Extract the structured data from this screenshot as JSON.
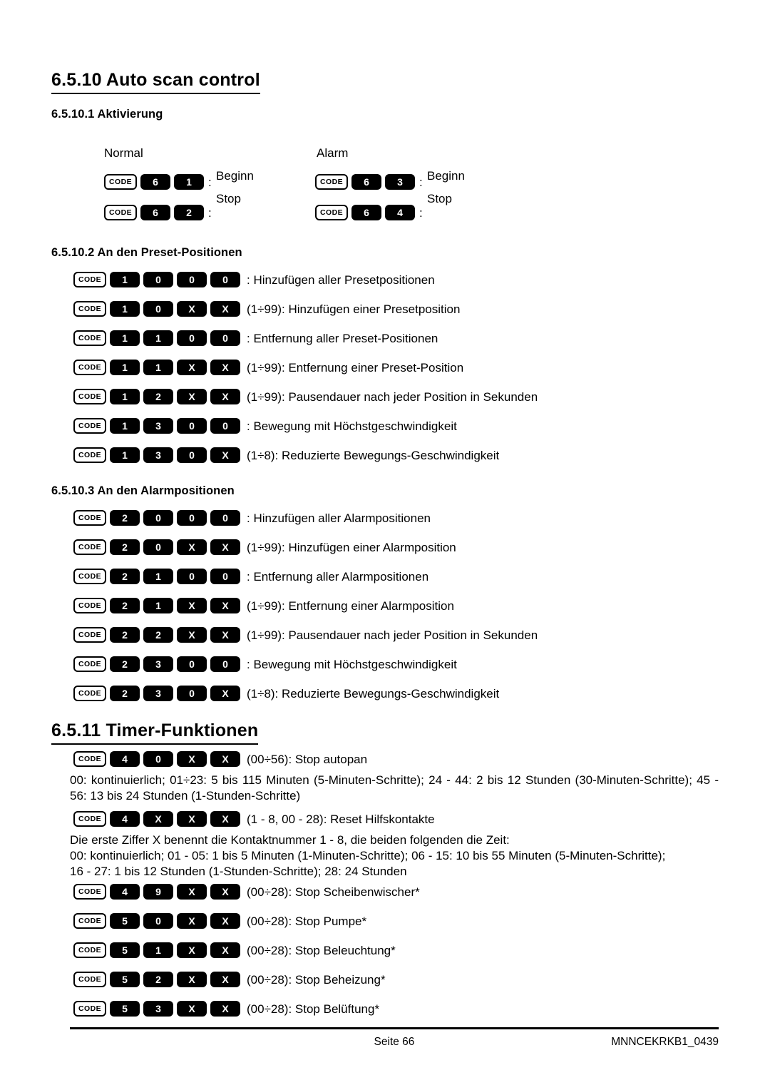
{
  "document": {
    "section": {
      "number_title": "6.5.10 Auto scan control",
      "subsections": [
        {
          "title": "6.5.10.1 Aktivierung"
        },
        {
          "title": "6.5.10.2 An den Preset-Positionen"
        },
        {
          "title": "6.5.10.3 An den Alarmpositionen"
        }
      ]
    },
    "section2": {
      "number_title": "6.5.11 Timer-Funktionen"
    }
  },
  "activation": {
    "column_headers": {
      "normal": "Normal",
      "alarm": "Alarm"
    },
    "labels": {
      "beginn": "Beginn",
      "stop": "Stop"
    },
    "normal_rows": [
      {
        "code": "CODE",
        "keys": [
          "6",
          "1"
        ],
        "colon": ":"
      },
      {
        "code": "CODE",
        "keys": [
          "6",
          "2"
        ],
        "colon": ":"
      }
    ],
    "alarm_rows": [
      {
        "code": "CODE",
        "keys": [
          "6",
          "3"
        ],
        "colon": ":"
      },
      {
        "code": "CODE",
        "keys": [
          "6",
          "4"
        ],
        "colon": ":"
      }
    ]
  },
  "preset_rows": [
    {
      "code": "CODE",
      "keys": [
        "1",
        "0",
        "0",
        "0"
      ],
      "desc": ": Hinzufügen aller Presetpositionen"
    },
    {
      "code": "CODE",
      "keys": [
        "1",
        "0",
        "X",
        "X"
      ],
      "desc": "(1÷99): Hinzufügen einer Presetposition"
    },
    {
      "code": "CODE",
      "keys": [
        "1",
        "1",
        "0",
        "0"
      ],
      "desc": ": Entfernung aller Preset-Positionen"
    },
    {
      "code": "CODE",
      "keys": [
        "1",
        "1",
        "X",
        "X"
      ],
      "desc": "(1÷99): Entfernung einer Preset-Position"
    },
    {
      "code": "CODE",
      "keys": [
        "1",
        "2",
        "X",
        "X"
      ],
      "desc": "(1÷99): Pausendauer nach jeder Position in Sekunden"
    },
    {
      "code": "CODE",
      "keys": [
        "1",
        "3",
        "0",
        "0"
      ],
      "desc": ": Bewegung mit Höchstgeschwindigkeit"
    },
    {
      "code": "CODE",
      "keys": [
        "1",
        "3",
        "0",
        "X"
      ],
      "desc": "(1÷8): Reduzierte Bewegungs-Geschwindigkeit"
    }
  ],
  "alarm_rows": [
    {
      "code": "CODE",
      "keys": [
        "2",
        "0",
        "0",
        "0"
      ],
      "desc": ": Hinzufügen aller Alarmpositionen"
    },
    {
      "code": "CODE",
      "keys": [
        "2",
        "0",
        "X",
        "X"
      ],
      "desc": "(1÷99): Hinzufügen einer Alarmposition"
    },
    {
      "code": "CODE",
      "keys": [
        "2",
        "1",
        "0",
        "0"
      ],
      "desc": ": Entfernung aller Alarmpositionen"
    },
    {
      "code": "CODE",
      "keys": [
        "2",
        "1",
        "X",
        "X"
      ],
      "desc": "(1÷99): Entfernung einer Alarmposition"
    },
    {
      "code": "CODE",
      "keys": [
        "2",
        "2",
        "X",
        "X"
      ],
      "desc": "(1÷99): Pausendauer nach jeder Position in Sekunden"
    },
    {
      "code": "CODE",
      "keys": [
        "2",
        "3",
        "0",
        "0"
      ],
      "desc": ": Bewegung mit Höchstgeschwindigkeit"
    },
    {
      "code": "CODE",
      "keys": [
        "2",
        "3",
        "0",
        "X"
      ],
      "desc": "(1÷8): Reduzierte Bewegungs-Geschwindigkeit"
    }
  ],
  "timer": {
    "autopan_row": {
      "code": "CODE",
      "keys": [
        "4",
        "0",
        "X",
        "X"
      ],
      "desc": "(00÷56): Stop autopan"
    },
    "autopan_note": "00: kontinuierlich; 01÷23: 5 bis 115 Minuten (5-Minuten-Schritte); 24 - 44: 2 bis 12 Stunden (30-Minuten-Schritte); 45 - 56: 13 bis 24 Stunden (1-Stunden-Schritte)",
    "reset_row": {
      "code": "CODE",
      "keys": [
        "4",
        "X",
        "X",
        "X"
      ],
      "desc": "(1 - 8, 00 - 28): Reset Hilfskontakte"
    },
    "reset_note_line1": "Die erste Ziffer X benennt die Kontaktnummer 1 - 8, die beiden folgenden die Zeit:",
    "reset_note_line2": "00: kontinuierlich; 01 - 05: 1 bis 5 Minuten (1-Minuten-Schritte); 06 - 15: 10 bis 55 Minuten (5-Minuten-Schritte);",
    "reset_note_line3": "16 - 27: 1 bis 12 Stunden (1-Stunden-Schritte); 28: 24 Stunden",
    "rows": [
      {
        "code": "CODE",
        "keys": [
          "4",
          "9",
          "X",
          "X"
        ],
        "desc": "(00÷28): Stop Scheibenwischer*"
      },
      {
        "code": "CODE",
        "keys": [
          "5",
          "0",
          "X",
          "X"
        ],
        "desc": "(00÷28): Stop Pumpe*"
      },
      {
        "code": "CODE",
        "keys": [
          "5",
          "1",
          "X",
          "X"
        ],
        "desc": "(00÷28): Stop Beleuchtung*"
      },
      {
        "code": "CODE",
        "keys": [
          "5",
          "2",
          "X",
          "X"
        ],
        "desc": "(00÷28): Stop Beheizung*"
      },
      {
        "code": "CODE",
        "keys": [
          "5",
          "3",
          "X",
          "X"
        ],
        "desc": "(00÷28): Stop Belüftung*"
      }
    ]
  },
  "footer": {
    "page_label": "Seite 66",
    "doc_code": "MNNCEKRKB1_0439"
  }
}
